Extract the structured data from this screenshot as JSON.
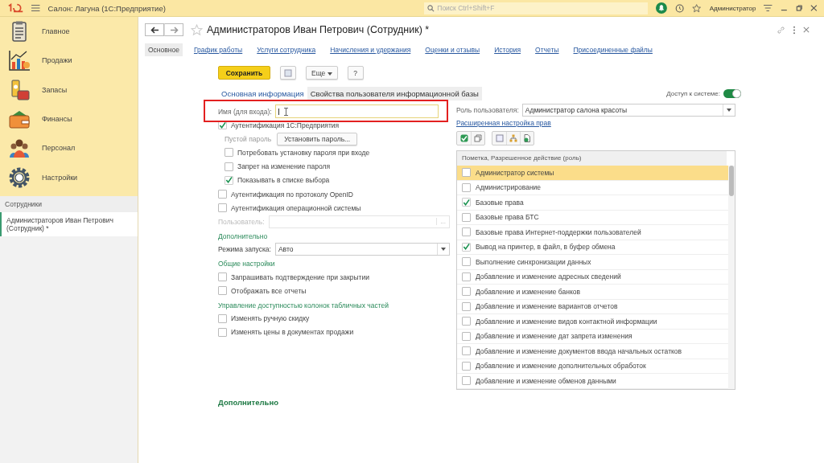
{
  "app_header": {
    "title": "Салон: Лагуна  (1С:Предприятие)",
    "search_placeholder": "Поиск Ctrl+Shift+F",
    "user": "Администратор"
  },
  "sidebar": {
    "sections": [
      {
        "label": "Главное"
      },
      {
        "label": "Продажи"
      },
      {
        "label": "Запасы"
      },
      {
        "label": "Финансы"
      },
      {
        "label": "Персонал"
      },
      {
        "label": "Настройки"
      }
    ],
    "open_header": "Сотрудники",
    "open_items": [
      {
        "label": "Администраторов Иван Петрович (Сотрудник) *",
        "selected": true
      }
    ]
  },
  "form": {
    "title": "Администраторов Иван Петрович (Сотрудник) *",
    "tabs": [
      {
        "label": "Основное",
        "selected": true
      },
      {
        "label": "График работы",
        "selected": false
      },
      {
        "label": "Услуги сотрудника",
        "selected": false
      },
      {
        "label": "Начисления и удержания",
        "selected": false
      },
      {
        "label": "Оценки и отзывы",
        "selected": false
      },
      {
        "label": "История",
        "selected": false
      },
      {
        "label": "Отчеты",
        "selected": false
      },
      {
        "label": "Присоединенные файлы",
        "selected": false
      }
    ],
    "toolbar": {
      "save": "Сохранить",
      "more": "Еще",
      "help": "?"
    },
    "subtabs": [
      {
        "label": "Основная информация",
        "selected": false
      },
      {
        "label": "Свойства пользователя информационной базы",
        "selected": true
      }
    ],
    "access": {
      "label": "Доступ к системе:",
      "on": true
    },
    "login": {
      "label": "Имя (для входа):",
      "highlighted": true
    },
    "left": [
      {
        "kind": "checkbox",
        "label": "Аутентификация 1С:Предприятия",
        "checked": true,
        "children": [
          {
            "kind": "password",
            "label": "Пустой пароль",
            "button": "Установить пароль..."
          },
          {
            "kind": "checkbox",
            "label": "Потребовать установку пароля при входе",
            "checked": false
          },
          {
            "kind": "checkbox",
            "label": "Запрет на изменение пароля",
            "checked": false
          },
          {
            "kind": "checkbox",
            "label": "Показывать в списке выбора",
            "checked": true
          }
        ]
      },
      {
        "kind": "checkbox",
        "label": "Аутентификация по протоколу OpenID",
        "checked": false
      },
      {
        "kind": "checkbox",
        "label": "Аутентификация операционной системы",
        "checked": false
      },
      {
        "kind": "lookup",
        "label": "Пользователь:",
        "button": "...",
        "disabled": true
      },
      {
        "kind": "heading",
        "label": "Дополнительно"
      },
      {
        "kind": "select",
        "label": "Режима запуска:",
        "value": "Авто"
      },
      {
        "kind": "heading",
        "label": "Общие настройки"
      },
      {
        "kind": "checkbox",
        "label": "Запрашивать подтверждение при закрытии",
        "checked": false
      },
      {
        "kind": "checkbox",
        "label": "Отображать все отчеты",
        "checked": false
      },
      {
        "kind": "heading",
        "label": "Управление доступностью колонок табличных частей"
      },
      {
        "kind": "checkbox",
        "label": "Изменять ручную скидку",
        "checked": false
      },
      {
        "kind": "checkbox",
        "label": "Изменять цены в документах продажи",
        "checked": false
      }
    ],
    "role": {
      "label": "Роль пользователя:",
      "value": "Администратор салона красоты"
    },
    "rights_link": "Расширенная настройка прав",
    "rights_header": "Пометка, Разрешенное действие (роль)",
    "rights": [
      {
        "label": "Администратор системы",
        "checked": false,
        "selected": true
      },
      {
        "label": "Администрирование",
        "checked": false,
        "selected": false
      },
      {
        "label": "Базовые права",
        "checked": true,
        "selected": false
      },
      {
        "label": "Базовые права БТС",
        "checked": false,
        "selected": false
      },
      {
        "label": "Базовые права Интернет-поддержки пользователей",
        "checked": false,
        "selected": false
      },
      {
        "label": "Вывод на принтер, в файл, в буфер обмена",
        "checked": true,
        "selected": false
      },
      {
        "label": "Выполнение синхронизации данных",
        "checked": false,
        "selected": false
      },
      {
        "label": "Добавление и изменение адресных сведений",
        "checked": false,
        "selected": false
      },
      {
        "label": "Добавление и изменение банков",
        "checked": false,
        "selected": false
      },
      {
        "label": "Добавление и изменение вариантов отчетов",
        "checked": false,
        "selected": false
      },
      {
        "label": "Добавление и изменение видов контактной информации",
        "checked": false,
        "selected": false
      },
      {
        "label": "Добавление и изменение дат запрета изменения",
        "checked": false,
        "selected": false
      },
      {
        "label": "Добавление и изменение документов ввода начальных остатков",
        "checked": false,
        "selected": false
      },
      {
        "label": "Добавление и изменение дополнительных обработок",
        "checked": false,
        "selected": false
      },
      {
        "label": "Добавление и изменение обменов данными",
        "checked": false,
        "selected": false
      }
    ],
    "footer_heading": "Дополнительно"
  }
}
